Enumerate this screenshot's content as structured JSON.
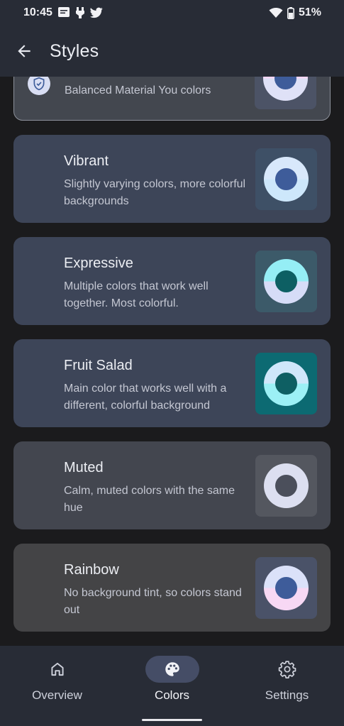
{
  "status_bar": {
    "time": "10:45",
    "battery_text": "51%",
    "icons": [
      "message-icon",
      "usb-icon",
      "twitter-icon",
      "wifi-icon",
      "battery-icon"
    ]
  },
  "app_bar": {
    "title": "Styles",
    "back_icon": "arrow-back-icon"
  },
  "styles": [
    {
      "name": "tonal-spot",
      "title": "",
      "description": "Balanced Material You colors",
      "selected": true,
      "swatch": {
        "bg": "#4c5366",
        "top": "#f6d6f5",
        "bottom": "#dfe1f7",
        "center": "#3e5c9a"
      }
    },
    {
      "name": "vibrant",
      "title": "Vibrant",
      "description": "Slightly varying colors, more colorful backgrounds",
      "selected": false,
      "swatch": {
        "bg": "#3e5066",
        "top": "#d8e8fb",
        "bottom": "#cde7fb",
        "center": "#3e5c9a"
      }
    },
    {
      "name": "expressive",
      "title": "Expressive",
      "description": "Multiple colors that work well together. Most colorful.",
      "selected": false,
      "swatch": {
        "bg": "#3c5a69",
        "top": "#95eef5",
        "bottom": "#d6dcf7",
        "center": "#0d5f63"
      }
    },
    {
      "name": "fruit-salad",
      "title": "Fruit Salad",
      "description": "Main color that works well with a different, colorful background",
      "selected": false,
      "swatch": {
        "bg": "#0c6a72",
        "top": "#cfe7fa",
        "bottom": "#9cf0f5",
        "center": "#0e5f63"
      }
    },
    {
      "name": "muted",
      "title": "Muted",
      "description": "Calm, muted colors with the same hue",
      "selected": false,
      "swatch": {
        "bg": "#54575f",
        "top": "#dcdff0",
        "bottom": "#dcdff0",
        "center": "#4b4f5b"
      }
    },
    {
      "name": "rainbow",
      "title": "Rainbow",
      "description": "No background tint, so colors stand out",
      "selected": false,
      "swatch": {
        "bg": "#4a5268",
        "top": "#dbe1f9",
        "bottom": "#f7d8f4",
        "center": "#3e5c9a"
      }
    }
  ],
  "bottom_nav": {
    "items": [
      {
        "label": "Overview",
        "icon": "home-icon",
        "active": false
      },
      {
        "label": "Colors",
        "icon": "palette-icon",
        "active": true
      },
      {
        "label": "Settings",
        "icon": "gear-icon",
        "active": false
      }
    ]
  },
  "colors": {
    "background": "#1b1b1d",
    "surface": "#282c36",
    "selected_card": "#43474f",
    "selected_outline": "#8c909a",
    "active_pill": "#454d66"
  }
}
